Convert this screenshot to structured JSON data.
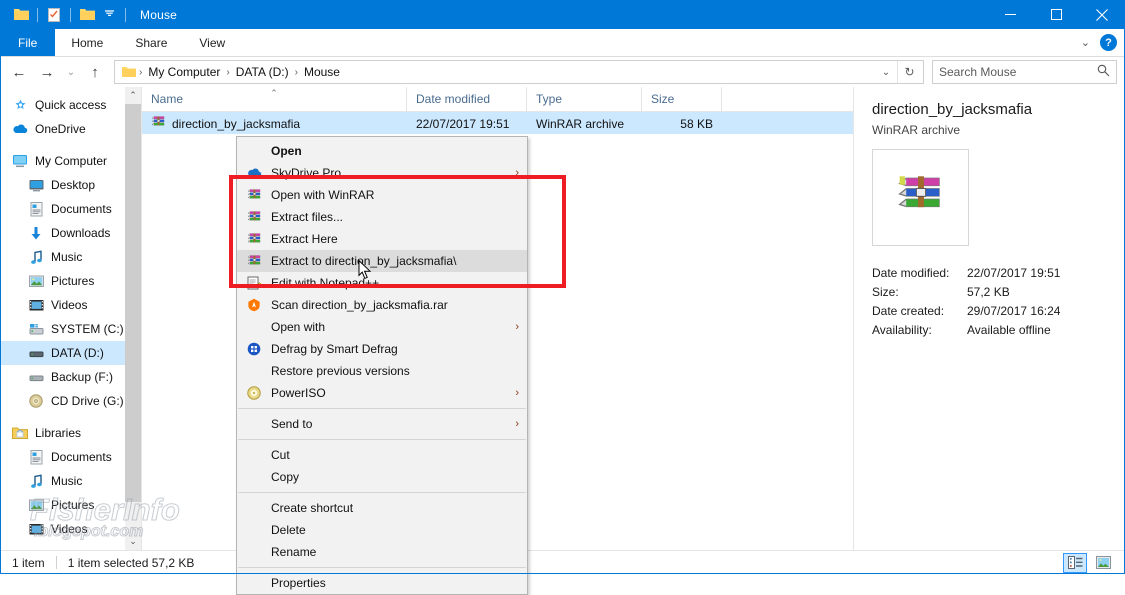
{
  "titlebar": {
    "title": "Mouse",
    "quick_access": [
      "folder-icon",
      "properties-icon",
      "new-folder-icon"
    ],
    "dropdown": "customize-quick-access-icon",
    "minimize": "minimize-icon",
    "maximize": "maximize-icon",
    "close": "close-icon"
  },
  "ribbon": {
    "tabs": [
      {
        "label": "File"
      },
      {
        "label": "Home"
      },
      {
        "label": "Share"
      },
      {
        "label": "View"
      }
    ],
    "expand": "chevron-down-icon",
    "help": "?"
  },
  "address": {
    "back": "←",
    "forward": "→",
    "recent": "⌄",
    "up": "↑",
    "crumbs": [
      "My Computer",
      "DATA (D:)",
      "Mouse"
    ],
    "separator": "›",
    "dropdown": "⌄",
    "refresh": "↻"
  },
  "search": {
    "placeholder": "Search Mouse",
    "icon": "search-icon"
  },
  "sidebar": {
    "groups": [
      {
        "items": [
          {
            "label": "Quick access",
            "icon": "star-icon",
            "level": 1,
            "selected": false
          },
          {
            "label": "OneDrive",
            "icon": "cloud-icon",
            "level": 1,
            "selected": false
          }
        ]
      },
      {
        "items": [
          {
            "label": "My Computer",
            "icon": "computer-icon",
            "level": 1,
            "selected": false
          },
          {
            "label": "Desktop",
            "icon": "desktop-icon",
            "level": 2,
            "selected": false
          },
          {
            "label": "Documents",
            "icon": "documents-icon",
            "level": 2,
            "selected": false
          },
          {
            "label": "Downloads",
            "icon": "downloads-icon",
            "level": 2,
            "selected": false
          },
          {
            "label": "Music",
            "icon": "music-icon",
            "level": 2,
            "selected": false
          },
          {
            "label": "Pictures",
            "icon": "pictures-icon",
            "level": 2,
            "selected": false
          },
          {
            "label": "Videos",
            "icon": "videos-icon",
            "level": 2,
            "selected": false
          },
          {
            "label": "SYSTEM (C:)",
            "icon": "drive-system-icon",
            "level": 2,
            "selected": false
          },
          {
            "label": "DATA (D:)",
            "icon": "drive-icon",
            "level": 2,
            "selected": true
          },
          {
            "label": "Backup (F:)",
            "icon": "drive-icon",
            "level": 2,
            "selected": false
          },
          {
            "label": "CD Drive (G:)",
            "icon": "cd-drive-icon",
            "level": 2,
            "selected": false
          }
        ]
      },
      {
        "items": [
          {
            "label": "Libraries",
            "icon": "libraries-icon",
            "level": 1,
            "selected": false
          },
          {
            "label": "Documents",
            "icon": "documents-icon",
            "level": 2,
            "selected": false
          },
          {
            "label": "Music",
            "icon": "music-icon",
            "level": 2,
            "selected": false
          },
          {
            "label": "Pictures",
            "icon": "pictures-icon",
            "level": 2,
            "selected": false
          },
          {
            "label": "Videos",
            "icon": "videos-icon",
            "level": 2,
            "selected": false
          }
        ]
      }
    ],
    "scroll_up": "⌃",
    "scroll_down": "⌄"
  },
  "filelist": {
    "columns": [
      {
        "label": "Name",
        "sorted": true
      },
      {
        "label": "Date modified",
        "sorted": false
      },
      {
        "label": "Type",
        "sorted": false
      },
      {
        "label": "Size",
        "sorted": false
      }
    ],
    "sort_indicator": "⌃",
    "rows": [
      {
        "name": "direction_by_jacksmafia",
        "date_modified": "22/07/2017 19:51",
        "type": "WinRAR archive",
        "size": "58 KB",
        "icon": "winrar-archive-icon",
        "selected": true
      }
    ]
  },
  "details": {
    "title": "direction_by_jacksmafia",
    "subtitle": "WinRAR archive",
    "thumbnail": "winrar-archive-icon",
    "properties": [
      {
        "key": "Date modified:",
        "value": "22/07/2017 19:51"
      },
      {
        "key": "Size:",
        "value": "57,2 KB"
      },
      {
        "key": "Date created:",
        "value": "29/07/2017 16:24"
      },
      {
        "key": "Availability:",
        "value": "Available offline"
      }
    ]
  },
  "statusbar": {
    "count": "1 item",
    "selection": "1 item selected  57,2 KB",
    "views": [
      {
        "name": "details-view",
        "icon": "details-view-icon",
        "active": true
      },
      {
        "name": "large-icons-view",
        "icon": "large-icons-view-icon",
        "active": false
      }
    ]
  },
  "contextmenu": {
    "items": [
      {
        "label": "Open",
        "icon": null,
        "bold": true,
        "arrow": false,
        "hovered": false,
        "type": "item"
      },
      {
        "label": "SkyDrive Pro",
        "icon": "skydrive-icon",
        "bold": false,
        "arrow": true,
        "hovered": false,
        "type": "item"
      },
      {
        "label": "Open with WinRAR",
        "icon": "winrar-archive-icon",
        "bold": false,
        "arrow": false,
        "hovered": false,
        "type": "item"
      },
      {
        "label": "Extract files...",
        "icon": "winrar-archive-icon",
        "bold": false,
        "arrow": false,
        "hovered": false,
        "type": "item"
      },
      {
        "label": "Extract Here",
        "icon": "winrar-archive-icon",
        "bold": false,
        "arrow": false,
        "hovered": false,
        "type": "item"
      },
      {
        "label": "Extract to direction_by_jacksmafia\\",
        "icon": "winrar-archive-icon",
        "bold": false,
        "arrow": false,
        "hovered": true,
        "type": "item"
      },
      {
        "label": "Edit with Notepad++",
        "icon": "notepad-plus-plus-icon",
        "bold": false,
        "arrow": false,
        "hovered": false,
        "type": "item"
      },
      {
        "label": "Scan direction_by_jacksmafia.rar",
        "icon": "avast-icon",
        "bold": false,
        "arrow": false,
        "hovered": false,
        "type": "item"
      },
      {
        "label": "Open with",
        "icon": null,
        "bold": false,
        "arrow": true,
        "hovered": false,
        "type": "item"
      },
      {
        "label": "Defrag by Smart Defrag",
        "icon": "smart-defrag-icon",
        "bold": false,
        "arrow": false,
        "hovered": false,
        "type": "item"
      },
      {
        "label": "Restore previous versions",
        "icon": null,
        "bold": false,
        "arrow": false,
        "hovered": false,
        "type": "item"
      },
      {
        "label": "PowerISO",
        "icon": "poweriso-icon",
        "bold": false,
        "arrow": true,
        "hovered": false,
        "type": "item"
      },
      {
        "type": "separator"
      },
      {
        "label": "Send to",
        "icon": null,
        "bold": false,
        "arrow": true,
        "hovered": false,
        "type": "item"
      },
      {
        "type": "separator"
      },
      {
        "label": "Cut",
        "icon": null,
        "bold": false,
        "arrow": false,
        "hovered": false,
        "type": "item"
      },
      {
        "label": "Copy",
        "icon": null,
        "bold": false,
        "arrow": false,
        "hovered": false,
        "type": "item"
      },
      {
        "type": "separator"
      },
      {
        "label": "Create shortcut",
        "icon": null,
        "bold": false,
        "arrow": false,
        "hovered": false,
        "type": "item"
      },
      {
        "label": "Delete",
        "icon": null,
        "bold": false,
        "arrow": false,
        "hovered": false,
        "type": "item"
      },
      {
        "label": "Rename",
        "icon": null,
        "bold": false,
        "arrow": false,
        "hovered": false,
        "type": "item"
      },
      {
        "type": "separator"
      },
      {
        "label": "Properties",
        "icon": null,
        "bold": false,
        "arrow": false,
        "hovered": false,
        "type": "item"
      }
    ],
    "submenu_arrow": "›"
  },
  "annotation": {
    "highlight_color": "#ee1c23"
  },
  "watermark": {
    "line1": "FisherInfo",
    "line2": ".blogspot.com"
  }
}
